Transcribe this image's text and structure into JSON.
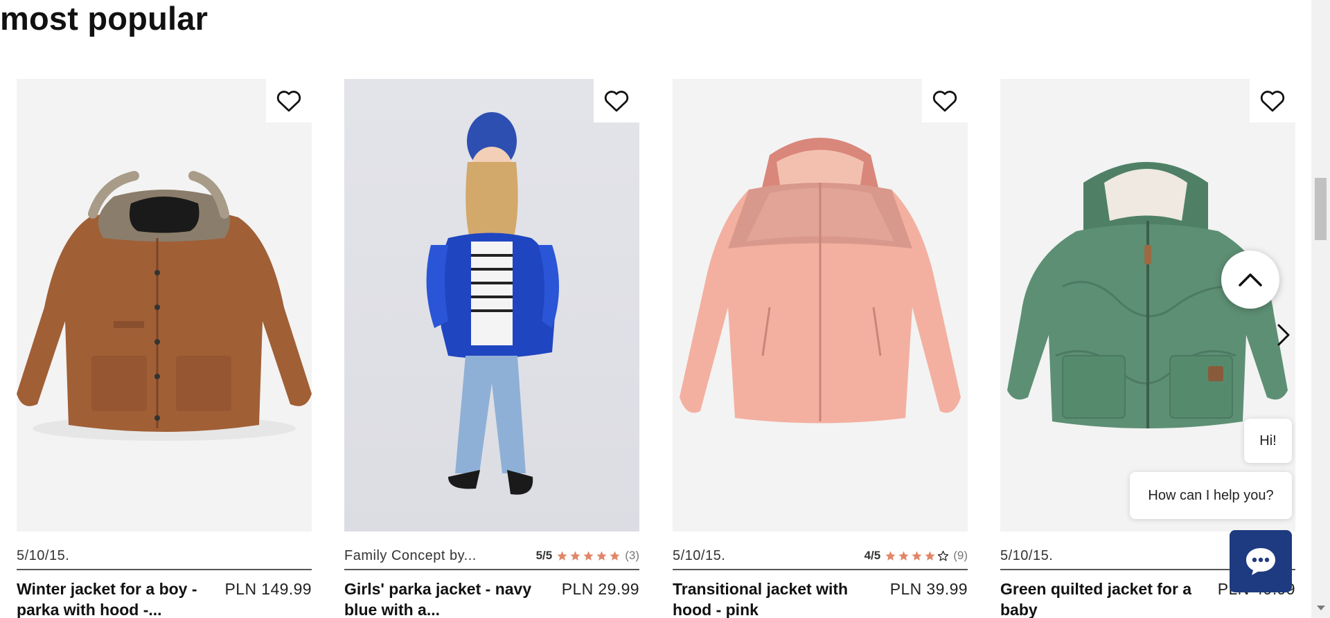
{
  "section": {
    "title": "most popular"
  },
  "products": [
    {
      "brand": "5/10/15.",
      "rating": null,
      "title": "Winter jacket for a boy - parka with hood -...",
      "price": "PLN 149.99"
    },
    {
      "brand": "Family Concept by...",
      "rating": {
        "score": "5/5",
        "stars": 5,
        "count": "(3)"
      },
      "title": "Girls' parka jacket - navy blue with a...",
      "price": "PLN 29.99"
    },
    {
      "brand": "5/10/15.",
      "rating": {
        "score": "4/5",
        "stars": 4,
        "count": "(9)"
      },
      "title": "Transitional jacket with hood - pink",
      "price": "PLN 39.99"
    },
    {
      "brand": "5/10/15.",
      "rating": null,
      "title": "Green quilted jacket for a baby",
      "price": "PLN 49.99"
    }
  ],
  "chat": {
    "greeting": "Hi!",
    "prompt": "How can I help you?"
  },
  "colors": {
    "star": "#e0876a",
    "chat_button": "#1e3a80",
    "heading": "#111111"
  },
  "icons": {
    "favorite": "heart-outline-icon",
    "next": "chevron-right-icon",
    "scroll_top": "chevron-up-icon",
    "chat": "chat-bubble-icon"
  }
}
